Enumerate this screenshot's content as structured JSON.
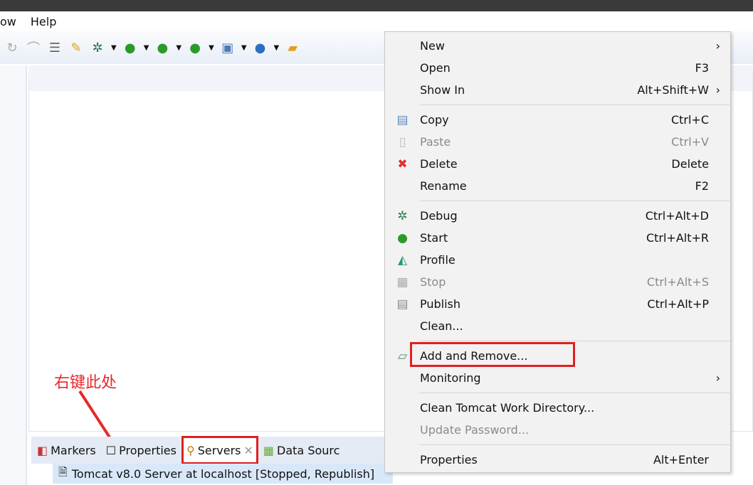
{
  "menubar": [
    "ow",
    "Help"
  ],
  "toolbar_icons": [
    "refresh-icon",
    "link-icon",
    "list-icon",
    "tools-icon",
    "debug-icon",
    "run-icon",
    "run-server-icon",
    "stop-server-icon",
    "new-server-icon",
    "spring-icon",
    "open-folder-icon"
  ],
  "tabs": [
    {
      "label": "Markers",
      "icon": "markers-icon"
    },
    {
      "label": "Properties",
      "icon": "properties-icon"
    },
    {
      "label": "Servers",
      "icon": "servers-icon",
      "active": true
    },
    {
      "label": "Data Sourc",
      "icon": "data-source-icon"
    }
  ],
  "server_row": "Tomcat v8.0 Server at localhost  [Stopped, Republish]",
  "annotation": "右键此处",
  "context_menu": [
    {
      "label": "New",
      "arrow": "›"
    },
    {
      "label": "Open",
      "shortcut": "F3"
    },
    {
      "label": "Show In",
      "shortcut": "Alt+Shift+W",
      "arrow": "›"
    },
    {
      "sep": true
    },
    {
      "label": "Copy",
      "shortcut": "Ctrl+C",
      "icon": "copy-icon"
    },
    {
      "label": "Paste",
      "shortcut": "Ctrl+V",
      "icon": "paste-icon",
      "disabled": true
    },
    {
      "label": "Delete",
      "shortcut": "Delete",
      "icon": "delete-icon"
    },
    {
      "label": "Rename",
      "shortcut": "F2"
    },
    {
      "sep": true
    },
    {
      "label": "Debug",
      "shortcut": "Ctrl+Alt+D",
      "icon": "debug-icon"
    },
    {
      "label": "Start",
      "shortcut": "Ctrl+Alt+R",
      "icon": "start-icon"
    },
    {
      "label": "Profile",
      "icon": "profile-icon"
    },
    {
      "label": "Stop",
      "shortcut": "Ctrl+Alt+S",
      "icon": "stop-icon",
      "disabled": true
    },
    {
      "label": "Publish",
      "shortcut": "Ctrl+Alt+P",
      "icon": "publish-icon"
    },
    {
      "label": "Clean..."
    },
    {
      "sep": true
    },
    {
      "label": "Add and Remove...",
      "icon": "add-remove-icon",
      "highlighted": true
    },
    {
      "label": "Monitoring",
      "arrow": "›"
    },
    {
      "sep": true
    },
    {
      "label": "Clean Tomcat Work Directory..."
    },
    {
      "label": "Update Password...",
      "disabled": true
    },
    {
      "sep": true
    },
    {
      "label": "Properties",
      "shortcut": "Alt+Enter"
    }
  ]
}
